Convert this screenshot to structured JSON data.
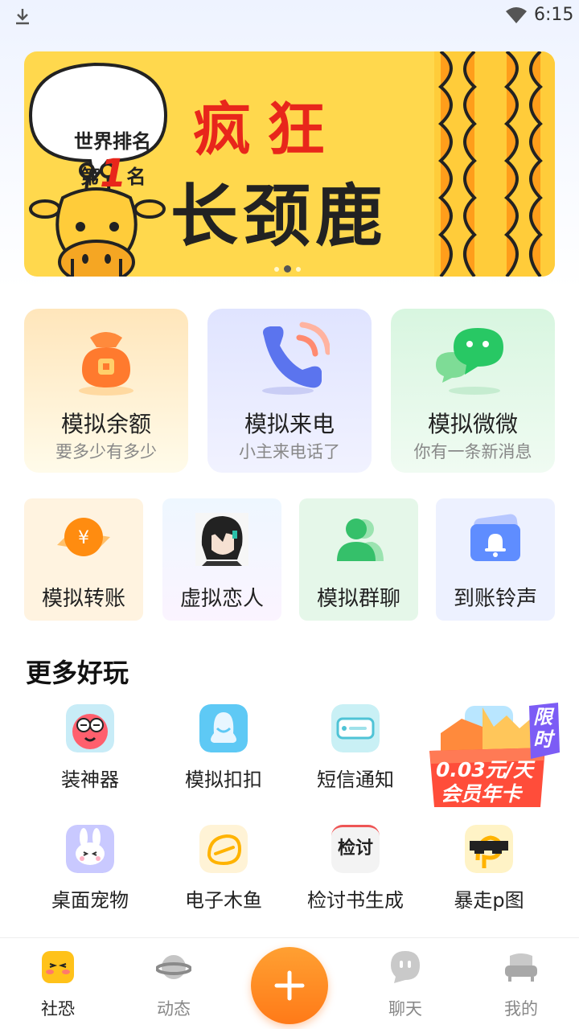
{
  "status_bar": {
    "time": "6:15"
  },
  "banner": {
    "badge_line1": "世界排名",
    "badge_line2_prefix": "第",
    "badge_rank": "1",
    "badge_line2_suffix": "名",
    "title_line1": "疯狂",
    "title_line2": "长颈鹿"
  },
  "feature_cards": [
    {
      "title": "模拟余额",
      "subtitle": "要多少有多少",
      "icon": "money-bag-icon"
    },
    {
      "title": "模拟来电",
      "subtitle": "小主来电话了",
      "icon": "phone-call-icon"
    },
    {
      "title": "模拟微微",
      "subtitle": "你有一条新消息",
      "icon": "chat-bubbles-icon"
    }
  ],
  "tool_cards": [
    {
      "title": "模拟转账",
      "icon": "yuan-coin-icon"
    },
    {
      "title": "虚拟恋人",
      "icon": "avatar-icon"
    },
    {
      "title": "模拟群聊",
      "icon": "group-users-icon"
    },
    {
      "title": "到账铃声",
      "icon": "bell-icon"
    }
  ],
  "more_section": {
    "title": "更多好玩",
    "items": [
      {
        "label": "装神器",
        "icon": "mask-face-icon"
      },
      {
        "label": "模拟扣扣",
        "icon": "penguin-icon"
      },
      {
        "label": "短信通知",
        "icon": "message-card-icon"
      },
      {
        "label": "",
        "icon": "promo-icon"
      },
      {
        "label": "桌面宠物",
        "icon": "bunny-icon"
      },
      {
        "label": "电子木鱼",
        "icon": "wooden-fish-icon"
      },
      {
        "label": "检讨书生成",
        "icon": "review-doc-icon",
        "icon_text": "检讨"
      },
      {
        "label": "暴走p图",
        "icon": "sunglasses-icon"
      }
    ]
  },
  "promo": {
    "price": "0.03元/天",
    "card": "会员年卡",
    "limit": "限时"
  },
  "bottom_nav": [
    {
      "label": "社恐",
      "icon": "shy-face-icon",
      "active": true
    },
    {
      "label": "动态",
      "icon": "planet-icon",
      "active": false
    },
    {
      "label": "聊天",
      "icon": "chat-face-icon",
      "active": false
    },
    {
      "label": "我的",
      "icon": "sofa-icon",
      "active": false
    }
  ],
  "colors": {
    "accent_orange": "#ff8a24",
    "banner_yellow": "#ffd84d",
    "banner_red": "#e8261b"
  }
}
